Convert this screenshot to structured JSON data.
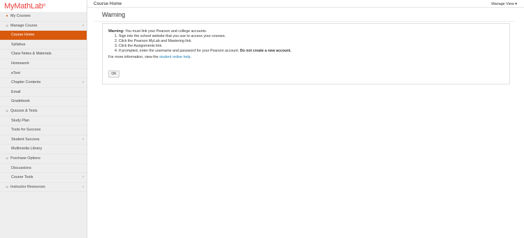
{
  "app": {
    "logo": "MyMathLab",
    "logo_mark": "®"
  },
  "sidebar": {
    "items": [
      {
        "label": "My Courses",
        "kind": "section",
        "icon": "my-courses-icon",
        "chevron": false
      },
      {
        "label": "Manage Course",
        "kind": "section",
        "icon": "person-icon",
        "chevron": true
      },
      {
        "label": "Course Home",
        "kind": "item",
        "active": true,
        "chevron": false
      },
      {
        "label": "Syllabus",
        "kind": "item",
        "chevron": false
      },
      {
        "label": "Class Notes & Materials",
        "kind": "item",
        "chevron": false
      },
      {
        "label": "Homework",
        "kind": "item",
        "chevron": false
      },
      {
        "label": "eText",
        "kind": "item",
        "chevron": false
      },
      {
        "label": "Chapter Contents",
        "kind": "item",
        "chevron": true
      },
      {
        "label": "Email",
        "kind": "item",
        "chevron": false
      },
      {
        "label": "Gradebook",
        "kind": "item",
        "chevron": false
      },
      {
        "label": "Quizzes & Tests",
        "kind": "section",
        "icon": "person-icon",
        "chevron": false
      },
      {
        "label": "Study Plan",
        "kind": "item",
        "chevron": false
      },
      {
        "label": "Tools for Success",
        "kind": "item",
        "chevron": false
      },
      {
        "label": "Student Success",
        "kind": "item",
        "chevron": true
      },
      {
        "label": "Multimedia Library",
        "kind": "item",
        "chevron": false
      },
      {
        "label": "Purchase Options",
        "kind": "section",
        "icon": "person-icon",
        "chevron": false
      },
      {
        "label": "Discussions",
        "kind": "item",
        "chevron": false
      },
      {
        "label": "Course Tools",
        "kind": "item",
        "chevron": true
      },
      {
        "label": "Instructor Resources",
        "kind": "section",
        "icon": "person-icon",
        "chevron": true
      }
    ]
  },
  "header": {
    "title": "Course Home",
    "manage_view": "Manage View"
  },
  "main": {
    "heading": "Warning",
    "warning_label": "Warning:",
    "warning_text": " You must link your Pearson and college accounts.",
    "steps": [
      "1.  Sign into the school website that you use to access your courses.",
      "2.  Click the Pearson MyLab and Mastering link.",
      "3.  Click the Assignments link."
    ],
    "step4_text": "4.  If prompted, enter the username and password for your Pearson account. ",
    "step4_bold": "Do not create a new account.",
    "more_info_prefix": "For more information, view the ",
    "more_info_link": "student online help",
    "more_info_suffix": ".",
    "ok_label": "OK"
  },
  "colors": {
    "accent": "#d9590d",
    "logo": "#ee3d3d",
    "link": "#1a7fb5"
  }
}
